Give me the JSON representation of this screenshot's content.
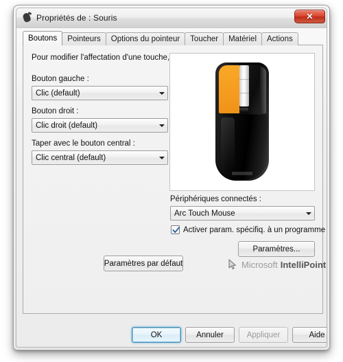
{
  "window": {
    "title": "Propriétés de : Souris",
    "icon": "mouse-icon",
    "close_label": "✕"
  },
  "tabs": [
    {
      "label": "Boutons",
      "active": true
    },
    {
      "label": "Pointeurs",
      "active": false
    },
    {
      "label": "Options du pointeur",
      "active": false
    },
    {
      "label": "Toucher",
      "active": false
    },
    {
      "label": "Matériel",
      "active": false
    },
    {
      "label": "Actions",
      "active": false
    }
  ],
  "content": {
    "hint": "Pour modifier l'affectation d'une touche, cliquez sur une commande dans la liste.",
    "fields": [
      {
        "label": "Bouton gauche :",
        "value": "Clic (default)"
      },
      {
        "label": "Bouton droit :",
        "value": "Clic droit (default)"
      },
      {
        "label": "Taper avec le bouton central :",
        "value": "Clic central (default)"
      }
    ],
    "devices": {
      "label": "Périphériques connectés :",
      "value": "Arc Touch Mouse"
    },
    "program_checkbox": {
      "label": "Activer param. spécifiq. à un programme",
      "checked": true
    },
    "settings_button": "Paramètres...",
    "defaults_button": "Paramètres par défaut",
    "device_image": {
      "name": "arc-touch-mouse-illustration",
      "body_color": "#000000",
      "highlight_color": "#f59b1f",
      "touch_strip_color": "#e8e8e8"
    }
  },
  "brand": {
    "vendor": "Microsoft",
    "product": "IntelliPoint",
    "icon": "cursor-arrow-icon"
  },
  "footer": {
    "ok": "OK",
    "cancel": "Annuler",
    "apply": "Appliquer",
    "apply_disabled": true,
    "help": "Aide"
  }
}
